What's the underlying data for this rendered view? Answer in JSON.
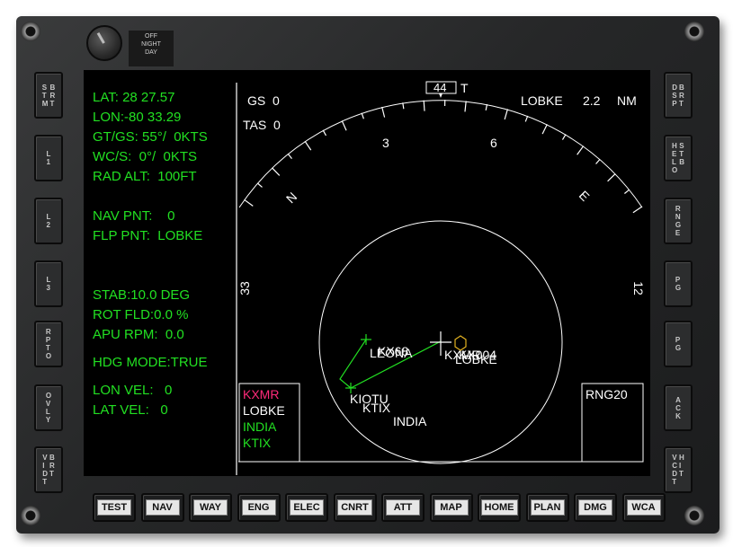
{
  "knob": {
    "labels": [
      "OFF",
      "NIGHT",
      "DAY"
    ]
  },
  "left_buttons": [
    {
      "name": "strm-brt-button",
      "cols": [
        [
          "S",
          "T",
          "M"
        ],
        [
          "B",
          "R",
          "T"
        ]
      ]
    },
    {
      "name": "l1-button",
      "cols": [
        [
          "L",
          "1"
        ]
      ]
    },
    {
      "name": "l2-button",
      "cols": [
        [
          "L",
          "2"
        ]
      ]
    },
    {
      "name": "l3-button",
      "cols": [
        [
          "L",
          "3"
        ]
      ]
    },
    {
      "name": "rpto-button",
      "cols": [
        [
          "R",
          "P",
          "T",
          "O"
        ]
      ]
    },
    {
      "name": "ovly-button",
      "cols": [
        [
          "O",
          "V",
          "L",
          "Y"
        ]
      ]
    },
    {
      "name": "vidt-brt-button",
      "cols": [
        [
          "V",
          "I",
          "D",
          "T"
        ],
        [
          "B",
          "R",
          "T"
        ]
      ]
    }
  ],
  "right_buttons": [
    {
      "name": "dbsrpt-button",
      "cols": [
        [
          "D",
          "S",
          "P"
        ],
        [
          "B",
          "R",
          "T"
        ]
      ]
    },
    {
      "name": "helo-stb-button",
      "cols": [
        [
          "H",
          "E",
          "L",
          "O"
        ],
        [
          "S",
          "T",
          "B"
        ]
      ]
    },
    {
      "name": "rnge-button",
      "cols": [
        [
          "R",
          "N",
          "G",
          "E"
        ]
      ]
    },
    {
      "name": "pg-button-1",
      "cols": [
        [
          "P",
          "G"
        ]
      ]
    },
    {
      "name": "pg-button-2",
      "cols": [
        [
          "P",
          "G"
        ]
      ]
    },
    {
      "name": "ack-button",
      "cols": [
        [
          "A",
          "C",
          "K"
        ]
      ]
    },
    {
      "name": "vcdt-hit-button",
      "cols": [
        [
          "V",
          "C",
          "D",
          "T"
        ],
        [
          "H",
          "I",
          "T"
        ]
      ]
    }
  ],
  "bottom_buttons": [
    "TEST",
    "NAV",
    "WAY",
    "ENG",
    "ELEC",
    "CNRT",
    "ATT",
    "MAP",
    "HOME",
    "PLAN",
    "DMG",
    "WCA"
  ],
  "info": {
    "lat": "LAT: 28 27.57",
    "lon": "LON:-80 33.29",
    "gt_gs": "GT/GS: 55°/  0KTS",
    "wc_s": "WC/S:  0°/  0KTS",
    "rad_alt": "RAD ALT:  100FT",
    "nav_pnt": "NAV PNT:    0",
    "flp_pnt": "FLP PNT:  LOBKE",
    "stab": "STAB:10.0 DEG",
    "rot_fld": "ROT FLD:0.0 %",
    "apu_rpm": "APU RPM:  0.0",
    "hdg_mode": "HDG MODE:TRUE",
    "lon_vel": "LON VEL:   0",
    "lat_vel": "LAT VEL:   0"
  },
  "map": {
    "gs": "GS  0",
    "tas": "TAS  0",
    "heading": "44",
    "heading_ref": "T",
    "waypoint_name": "LOBKE",
    "waypoint_dist": "2.2",
    "waypoint_unit": "NM",
    "compass_labels": [
      "3",
      "6",
      "N",
      "E",
      "33",
      "12"
    ],
    "waypoints": [
      "LEONA",
      "KX68",
      "KXMR",
      "KX004",
      "LOBKE",
      "KIOTU",
      "KTIX",
      "INDIA"
    ],
    "legend": [
      "KXMR",
      "LOBKE",
      "INDIA",
      "KTIX"
    ],
    "range": "RNG20"
  },
  "colors": {
    "green": "#22e022",
    "magenta": "#ff2a7a",
    "white": "#ffffff",
    "yellow": "#e0b020"
  }
}
